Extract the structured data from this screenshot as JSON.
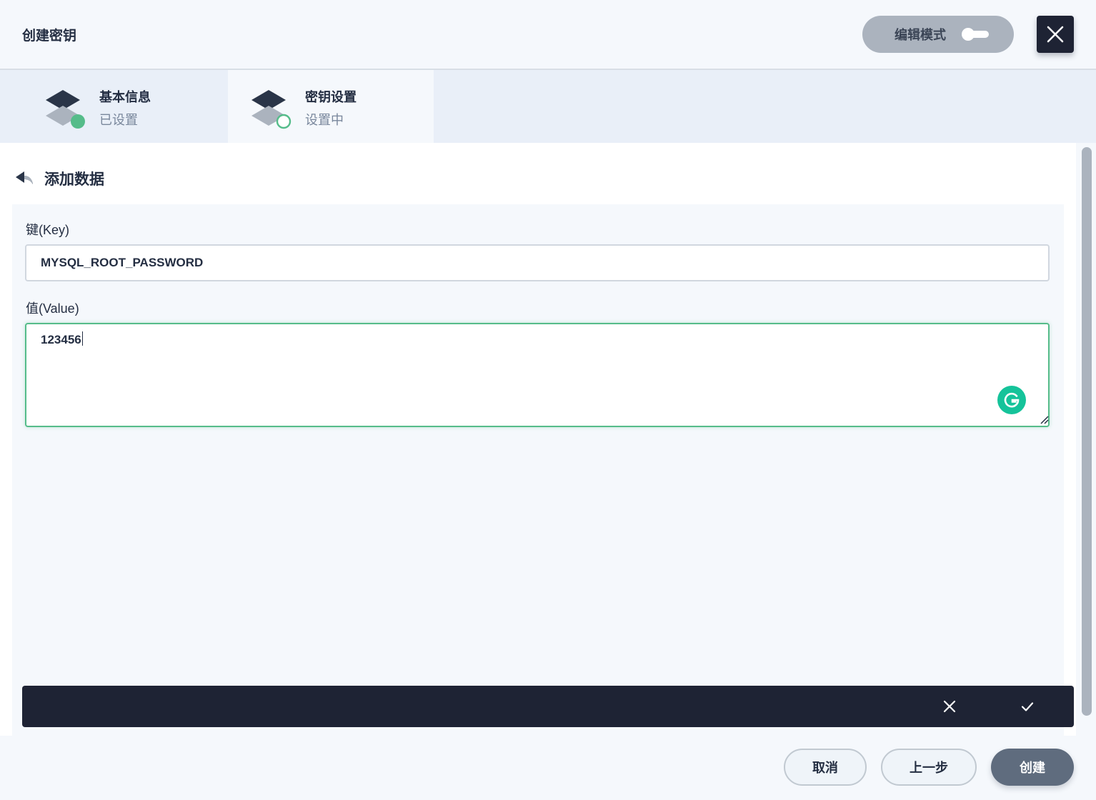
{
  "header": {
    "title": "创建密钥",
    "edit_mode_label": "编辑模式",
    "edit_mode_on": false
  },
  "steps": [
    {
      "name": "基本信息",
      "status": "已设置"
    },
    {
      "name": "密钥设置",
      "status": "设置中"
    }
  ],
  "content": {
    "title": "添加数据",
    "key_label": "键(Key)",
    "key_value": "MYSQL_ROOT_PASSWORD",
    "value_label": "值(Value)",
    "value_value": "123456"
  },
  "footer": {
    "cancel_label": "取消",
    "prev_label": "上一步",
    "create_label": "创建"
  },
  "colors": {
    "accent_green": "#55bc8a",
    "dark": "#1e2334",
    "grammarly": "#15c39a"
  }
}
